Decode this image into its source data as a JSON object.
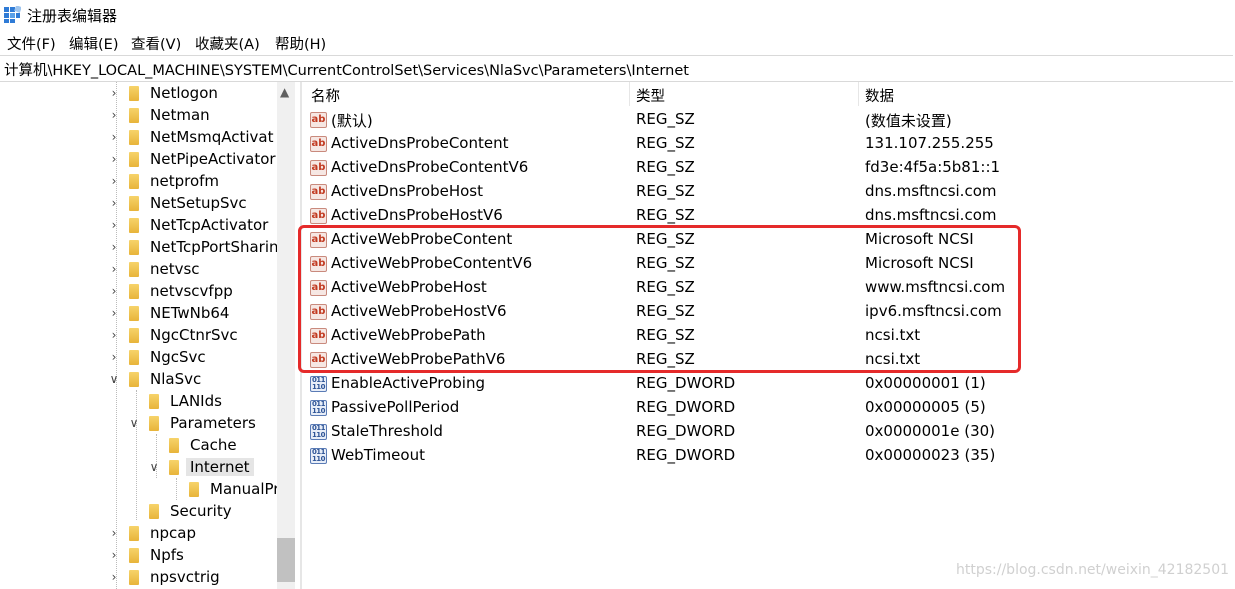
{
  "window": {
    "title": "注册表编辑器",
    "icon": "regedit-icon"
  },
  "menu": [
    "文件(F)",
    "编辑(E)",
    "查看(V)",
    "收藏夹(A)",
    "帮助(H)"
  ],
  "address": "计算机\\HKEY_LOCAL_MACHINE\\SYSTEM\\CurrentControlSet\\Services\\NlaSvc\\Parameters\\Internet",
  "tree": {
    "items": [
      {
        "label": "Netlogon",
        "level": 0,
        "chevron": "right"
      },
      {
        "label": "Netman",
        "level": 0,
        "chevron": "right"
      },
      {
        "label": "NetMsmqActivat",
        "level": 0,
        "chevron": "right"
      },
      {
        "label": "NetPipeActivator",
        "level": 0,
        "chevron": "right"
      },
      {
        "label": "netprofm",
        "level": 0,
        "chevron": "right"
      },
      {
        "label": "NetSetupSvc",
        "level": 0,
        "chevron": "right"
      },
      {
        "label": "NetTcpActivator",
        "level": 0,
        "chevron": "right"
      },
      {
        "label": "NetTcpPortSharin",
        "level": 0,
        "chevron": "right"
      },
      {
        "label": "netvsc",
        "level": 0,
        "chevron": "right"
      },
      {
        "label": "netvscvfpp",
        "level": 0,
        "chevron": "right"
      },
      {
        "label": "NETwNb64",
        "level": 0,
        "chevron": "right"
      },
      {
        "label": "NgcCtnrSvc",
        "level": 0,
        "chevron": "right"
      },
      {
        "label": "NgcSvc",
        "level": 0,
        "chevron": "right"
      },
      {
        "label": "NlaSvc",
        "level": 0,
        "chevron": "down"
      },
      {
        "label": "LANIds",
        "level": 1,
        "chevron": "none"
      },
      {
        "label": "Parameters",
        "level": 1,
        "chevron": "down"
      },
      {
        "label": "Cache",
        "level": 2,
        "chevron": "none"
      },
      {
        "label": "Internet",
        "level": 2,
        "chevron": "down",
        "selected": true
      },
      {
        "label": "ManualPr",
        "level": 3,
        "chevron": "none"
      },
      {
        "label": "Security",
        "level": 1,
        "chevron": "none"
      },
      {
        "label": "npcap",
        "level": 0,
        "chevron": "right"
      },
      {
        "label": "Npfs",
        "level": 0,
        "chevron": "right"
      },
      {
        "label": "npsvctrig",
        "level": 0,
        "chevron": "right"
      }
    ]
  },
  "columns": {
    "name": "名称",
    "type": "类型",
    "data": "数据"
  },
  "values": [
    {
      "name": "(默认)",
      "type": "REG_SZ",
      "data": "(数值未设置)",
      "icon": "string-value-icon"
    },
    {
      "name": "ActiveDnsProbeContent",
      "type": "REG_SZ",
      "data": "131.107.255.255",
      "icon": "string-value-icon"
    },
    {
      "name": "ActiveDnsProbeContentV6",
      "type": "REG_SZ",
      "data": "fd3e:4f5a:5b81::1",
      "icon": "string-value-icon"
    },
    {
      "name": "ActiveDnsProbeHost",
      "type": "REG_SZ",
      "data": "dns.msftncsi.com",
      "icon": "string-value-icon"
    },
    {
      "name": "ActiveDnsProbeHostV6",
      "type": "REG_SZ",
      "data": "dns.msftncsi.com",
      "icon": "string-value-icon"
    },
    {
      "name": "ActiveWebProbeContent",
      "type": "REG_SZ",
      "data": "Microsoft NCSI",
      "icon": "string-value-icon"
    },
    {
      "name": "ActiveWebProbeContentV6",
      "type": "REG_SZ",
      "data": "Microsoft NCSI",
      "icon": "string-value-icon"
    },
    {
      "name": "ActiveWebProbeHost",
      "type": "REG_SZ",
      "data": "www.msftncsi.com",
      "icon": "string-value-icon"
    },
    {
      "name": "ActiveWebProbeHostV6",
      "type": "REG_SZ",
      "data": "ipv6.msftncsi.com",
      "icon": "string-value-icon"
    },
    {
      "name": "ActiveWebProbePath",
      "type": "REG_SZ",
      "data": "ncsi.txt",
      "icon": "string-value-icon"
    },
    {
      "name": "ActiveWebProbePathV6",
      "type": "REG_SZ",
      "data": "ncsi.txt",
      "icon": "string-value-icon"
    },
    {
      "name": "EnableActiveProbing",
      "type": "REG_DWORD",
      "data": "0x00000001 (1)",
      "icon": "binary-value-icon"
    },
    {
      "name": "PassivePollPeriod",
      "type": "REG_DWORD",
      "data": "0x00000005 (5)",
      "icon": "binary-value-icon"
    },
    {
      "name": "StaleThreshold",
      "type": "REG_DWORD",
      "data": "0x0000001e (30)",
      "icon": "binary-value-icon"
    },
    {
      "name": "WebTimeout",
      "type": "REG_DWORD",
      "data": "0x00000023 (35)",
      "icon": "binary-value-icon"
    }
  ],
  "annotation": {
    "color": "#e52a2a"
  },
  "watermark": "https://blog.csdn.net/weixin_42182501"
}
